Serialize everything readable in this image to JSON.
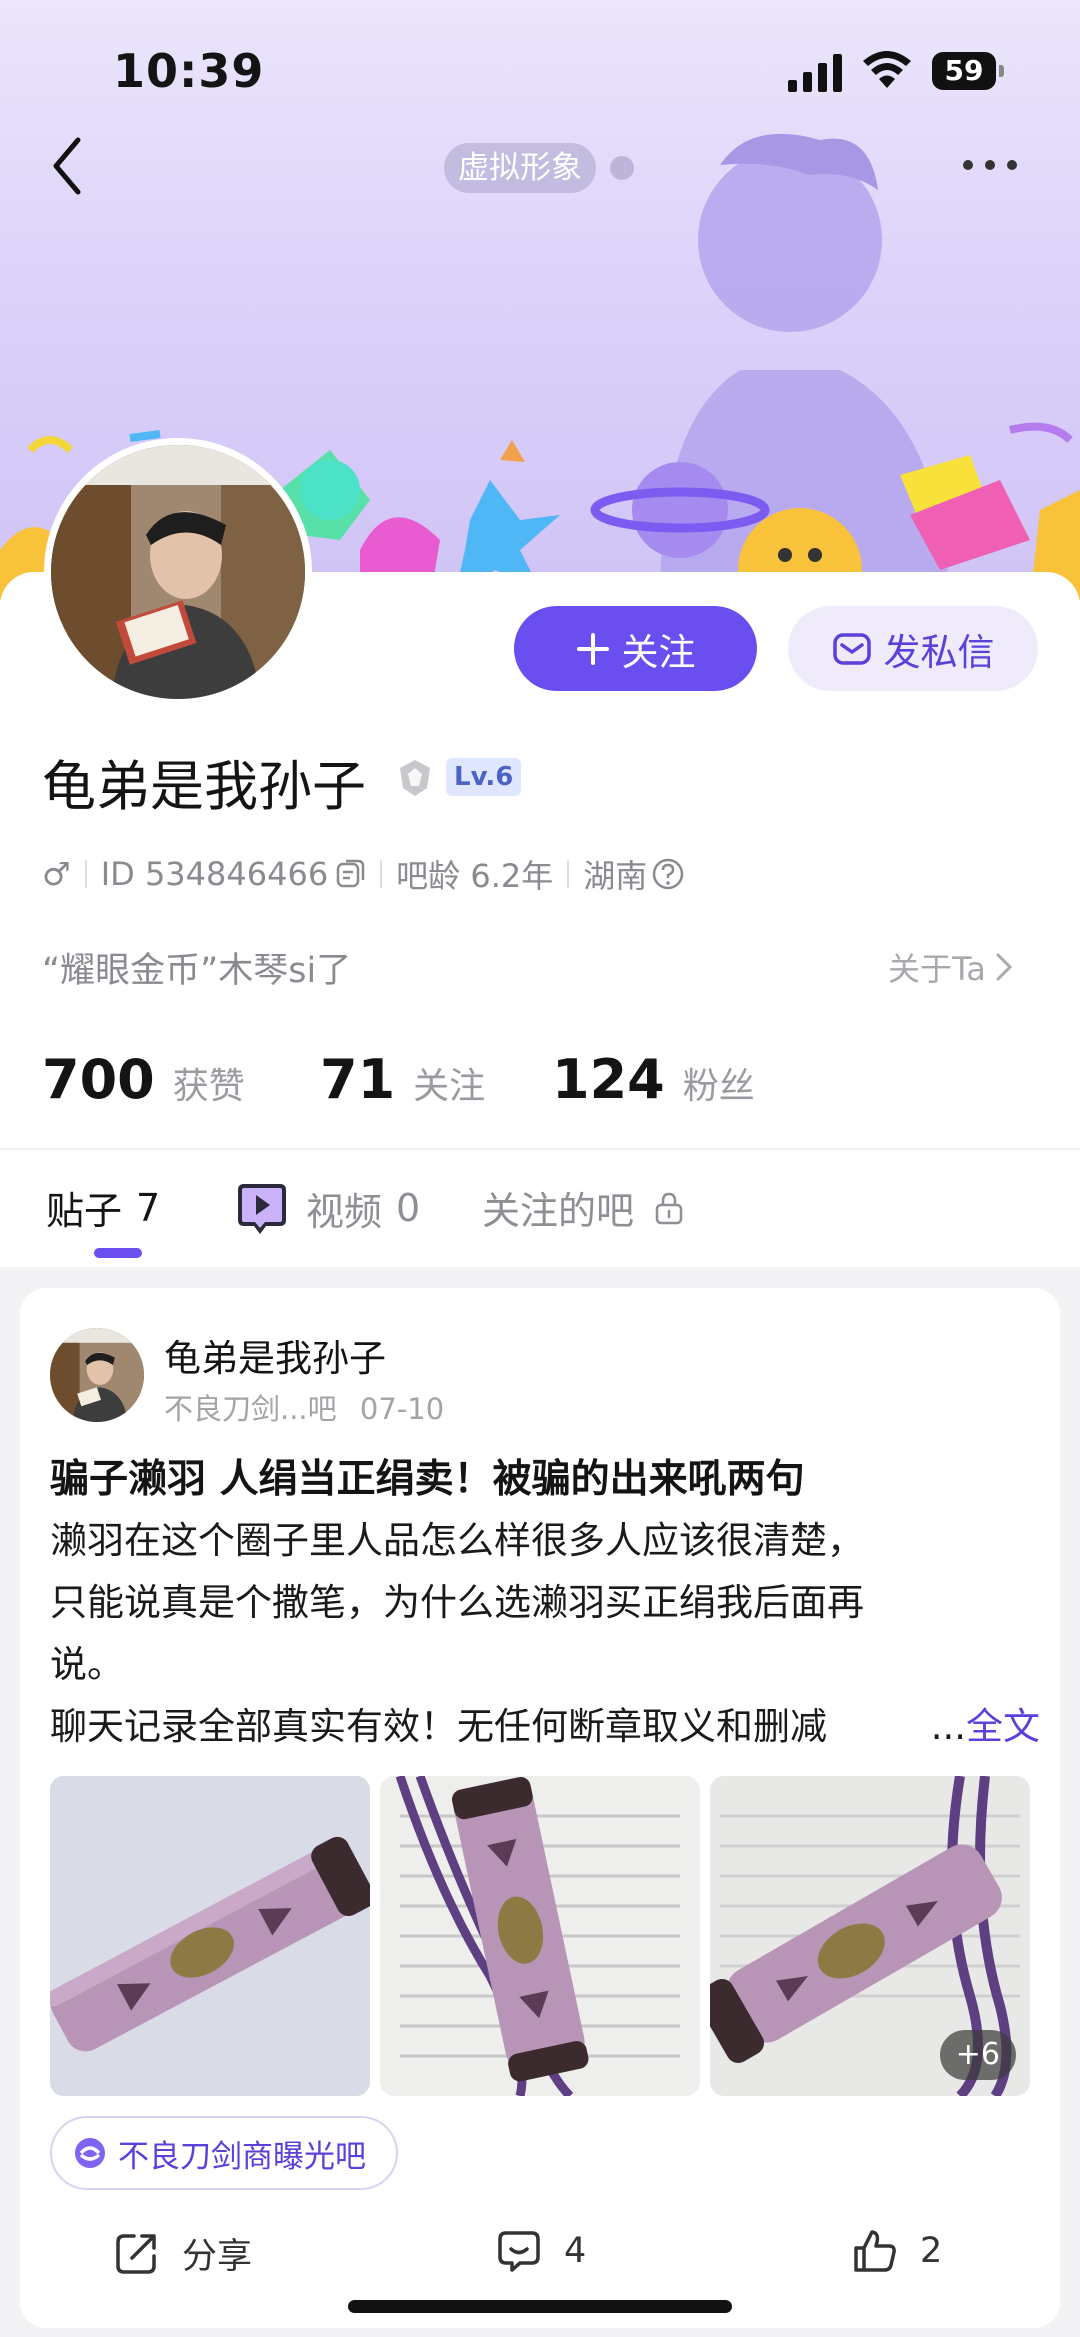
{
  "status_bar": {
    "time": "10:39",
    "battery": "59"
  },
  "header": {
    "virtual_label": "虚拟形象"
  },
  "profile": {
    "username": "龟弟是我孙子",
    "level": "Lv.6",
    "follow_label": "关注",
    "message_label": "发私信",
    "gender_symbol": "♂",
    "id_text": "ID 534846466",
    "age_text": "吧龄 6.2年",
    "location": "湖南",
    "signature": "“耀眼金币”木琴si了",
    "about_label": "关于Ta",
    "stats": [
      {
        "value": "700",
        "label": "获赞"
      },
      {
        "value": "71",
        "label": "关注"
      },
      {
        "value": "124",
        "label": "粉丝"
      }
    ]
  },
  "tabs": {
    "posts_label": "贴子",
    "posts_count": "7",
    "videos_label": "视频",
    "videos_count": "0",
    "forums_label": "关注的吧"
  },
  "post": {
    "author": "龟弟是我孙子",
    "forum_short": "不良刀剑...吧",
    "date": "07-10",
    "title": "骗子濑羽 人绢当正绢卖！被骗的出来吼两句",
    "line1": "濑羽在这个圈子里人品怎么样很多人应该很清楚，",
    "line2": "只能说真是个撒笔，为什么选濑羽买正绢我后面再",
    "line3": "说。",
    "line4": "聊天记录全部真实有效！无任何断章取义和删减",
    "ellipsis": "...",
    "full_text_label": "全文",
    "more_images": "+6",
    "forum_tag": "不良刀剑商曝光吧",
    "share_label": "分享",
    "comment_count": "4",
    "like_count": "2"
  },
  "colors": {
    "accent": "#6a4ef0",
    "accent_light": "#efebfb"
  }
}
